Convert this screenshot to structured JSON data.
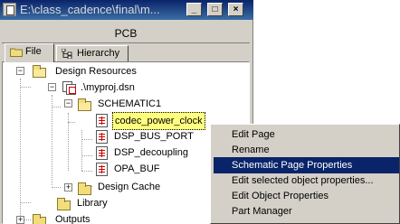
{
  "window": {
    "title": "E:\\class_cadence\\final\\m...",
    "minimize_glyph": "_",
    "restore_glyph": "□",
    "close_glyph": "×"
  },
  "pane": {
    "header": "PCB"
  },
  "tabs": [
    {
      "label": "File",
      "icon": "folder-icon",
      "active": true
    },
    {
      "label": "Hierarchy",
      "icon": "hierarchy-icon",
      "active": false
    }
  ],
  "tree": {
    "root": {
      "label": "Design Resources",
      "expanded": true
    },
    "design": {
      "label": ".\\myproj.dsn",
      "expanded": true
    },
    "schematic": {
      "label": "SCHEMATIC1",
      "expanded": true
    },
    "pages": [
      {
        "label": "codec_power_clock",
        "selected": true
      },
      {
        "label": "DSP_BUS_PORT",
        "selected": false
      },
      {
        "label": "DSP_decoupling",
        "selected": false
      },
      {
        "label": "OPA_BUF",
        "selected": false
      }
    ],
    "design_cache": {
      "label": "Design Cache",
      "expanded": false
    },
    "library": {
      "label": "Library"
    },
    "outputs": {
      "label": "Outputs",
      "expanded": false
    }
  },
  "context_menu": {
    "items": [
      {
        "label": "Edit Page",
        "highlighted": false
      },
      {
        "label": "Rename",
        "highlighted": false
      },
      {
        "label": "Schematic Page Properties",
        "highlighted": true
      },
      {
        "label": "Edit selected object properties...",
        "highlighted": false
      },
      {
        "label": "Edit Object Properties",
        "highlighted": false
      },
      {
        "label": "Part Manager",
        "highlighted": false
      }
    ]
  },
  "colors": {
    "title_bar": "#0a246a",
    "menu_highlight": "#0a246a",
    "selection_bg": "#ffff80",
    "folder": "#f3dd7b"
  }
}
